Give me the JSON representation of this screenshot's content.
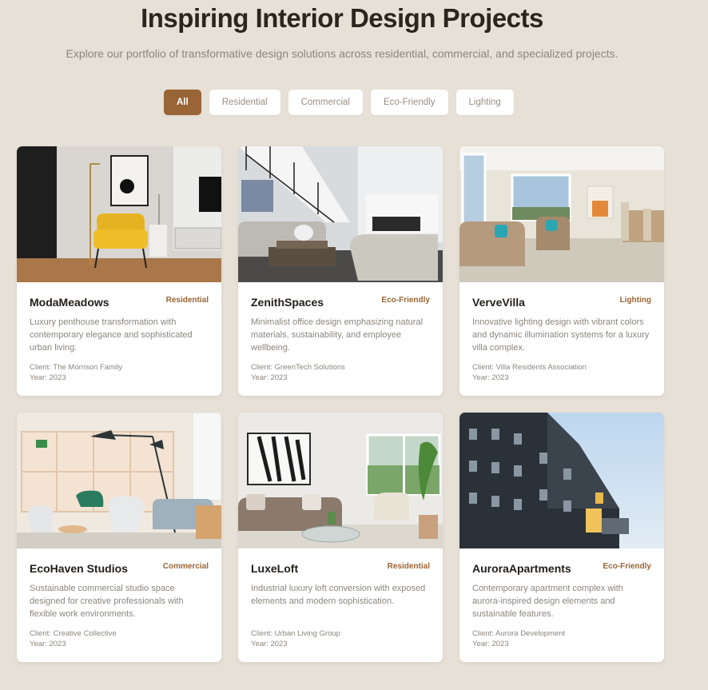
{
  "header": {
    "title": "Inspiring Interior Design Projects",
    "subtitle": "Explore our portfolio of transformative design solutions across residential, commercial, and specialized projects."
  },
  "filters": [
    {
      "label": "All",
      "active": true
    },
    {
      "label": "Residential",
      "active": false
    },
    {
      "label": "Commercial",
      "active": false
    },
    {
      "label": "Eco-Friendly",
      "active": false
    },
    {
      "label": "Lighting",
      "active": false
    }
  ],
  "projects": [
    {
      "title": "ModaMeadows",
      "tag": "Residential",
      "description": "Luxury penthouse transformation with contemporary elegance and sophisticated urban living.",
      "client": "Client: The Morrison Family",
      "year": "Year: 2023"
    },
    {
      "title": "ZenithSpaces",
      "tag": "Eco-Friendly",
      "description": "Minimalist office design emphasizing natural materials, sustainability, and employee wellbeing.",
      "client": "Client: GreenTech Solutions",
      "year": "Year: 2023"
    },
    {
      "title": "VerveVilla",
      "tag": "Lighting",
      "description": "Innovative lighting design with vibrant colors and dynamic illumination systems for a luxury villa complex.",
      "client": "Client: Villa Residents Association",
      "year": "Year: 2023"
    },
    {
      "title": "EcoHaven Studios",
      "tag": "Commercial",
      "description": "Sustainable commercial studio space designed for creative professionals with flexible work environments.",
      "client": "Client: Creative Collective",
      "year": "Year: 2023"
    },
    {
      "title": "LuxeLoft",
      "tag": "Residential",
      "description": "Industrial luxury loft conversion with exposed elements and modern sophistication.",
      "client": "Client: Urban Living Group",
      "year": "Year: 2023"
    },
    {
      "title": "AuroraApartments",
      "tag": "Eco-Friendly",
      "description": "Contemporary apartment complex with aurora-inspired design elements and sustainable features.",
      "client": "Client: Aurora Development",
      "year": "Year: 2023"
    }
  ],
  "colors": {
    "background": "#e7e0d6",
    "accent": "#9a6536",
    "card": "#ffffff"
  }
}
